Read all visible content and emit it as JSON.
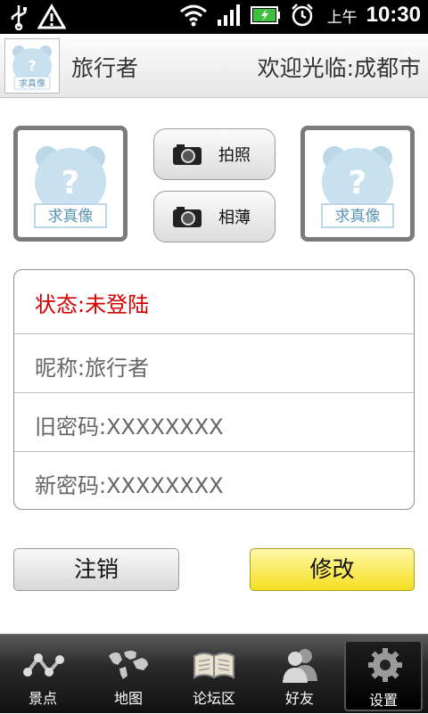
{
  "status_bar": {
    "ampm": "上午",
    "time": "10:30"
  },
  "header": {
    "username": "旅行者",
    "welcome": "欢迎光临:成都市"
  },
  "placeholder_caption": "求真像",
  "buttons": {
    "take_photo": "拍照",
    "album": "相薄",
    "logout": "注销",
    "modify": "修改"
  },
  "form": {
    "status": "状态:未登陆",
    "nickname": "昵称:旅行者",
    "old_password": "旧密码:XXXXXXXX",
    "new_password": "新密码:XXXXXXXX"
  },
  "tabs": [
    {
      "label": "景点",
      "icon": "route-icon"
    },
    {
      "label": "地图",
      "icon": "world-map-icon"
    },
    {
      "label": "论坛区",
      "icon": "book-icon"
    },
    {
      "label": "好友",
      "icon": "friends-icon"
    },
    {
      "label": "设置",
      "icon": "gear-icon",
      "active": true
    }
  ],
  "colors": {
    "status_red": "#d40000",
    "modify_yellow": "#f5df20",
    "placeholder_blue": "#c9e0ee"
  }
}
